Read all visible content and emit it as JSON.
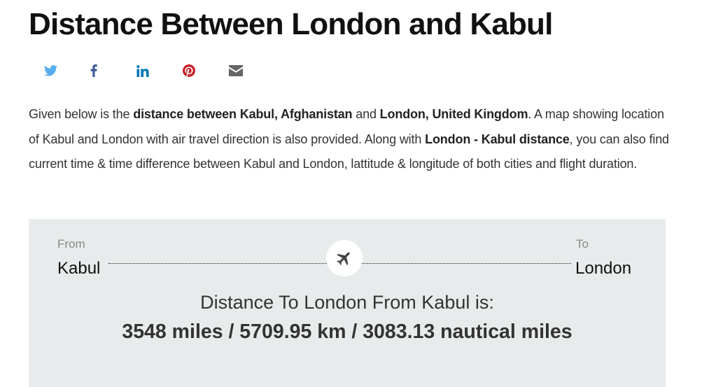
{
  "page": {
    "title": "Distance Between London and Kabul"
  },
  "share": {
    "buttons": [
      {
        "icon": "twitter-icon",
        "color": "#55acee"
      },
      {
        "icon": "facebook-icon",
        "color": "#3b5998"
      },
      {
        "icon": "linkedin-icon",
        "color": "#0077b5"
      },
      {
        "icon": "pinterest-icon",
        "color": "#cb2027"
      },
      {
        "icon": "email-icon",
        "color": "#666666"
      }
    ]
  },
  "intro": {
    "t1": "Given below is the ",
    "b1": "distance between Kabul, Afghanistan",
    "t2": " and ",
    "b2": "London, United Kingdom",
    "t3": ". A map showing location of Kabul and London with air travel direction is also provided. Along with ",
    "b3": "London - Kabul distance",
    "t4": ", you can also find current time & time difference between Kabul and London, lattitude & longitude of both cities and flight duration."
  },
  "route": {
    "from_label": "From",
    "from_city": "Kabul",
    "to_label": "To",
    "to_city": "London",
    "icon": "airplane-icon"
  },
  "distance": {
    "heading": "Distance To London From Kabul is:",
    "values": "3548 miles / 5709.95 km / 3083.13 nautical miles"
  },
  "colors": {
    "panel_background": "#e8ebeb",
    "title": "#111111",
    "body_text": "#333333"
  }
}
